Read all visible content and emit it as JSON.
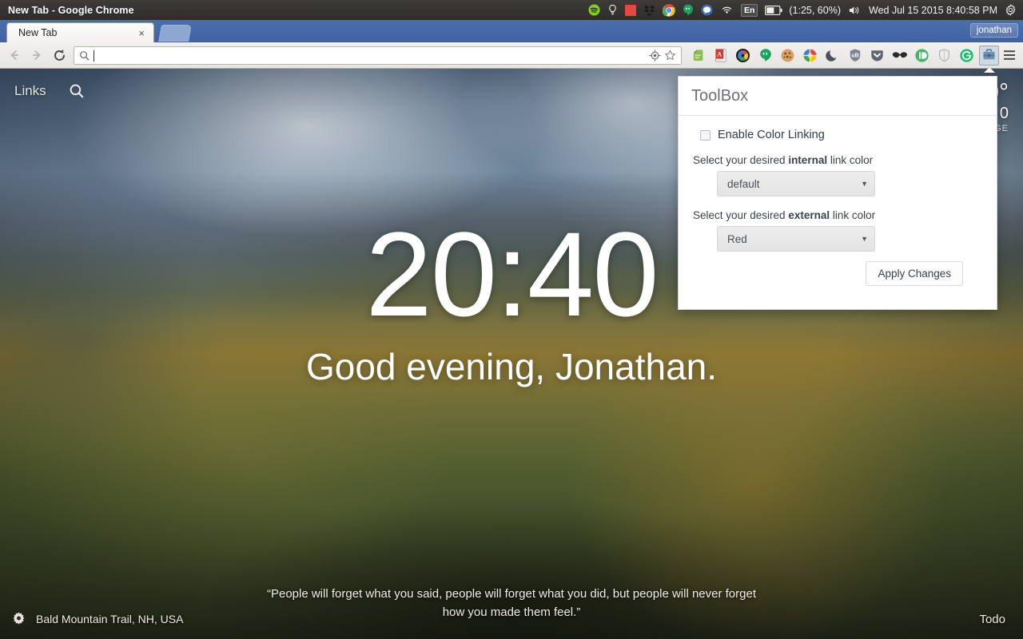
{
  "desktop": {
    "window_title": "New Tab - Google Chrome",
    "tray": {
      "icons": [
        {
          "name": "spotify-icon"
        },
        {
          "name": "lightbulb-icon"
        },
        {
          "name": "red-square-icon"
        },
        {
          "name": "dropbox-icon"
        },
        {
          "name": "chrome-icon"
        },
        {
          "name": "hangouts-icon"
        },
        {
          "name": "messaging-icon"
        },
        {
          "name": "wifi-icon"
        }
      ],
      "keyboard_layout": "En",
      "battery_status": "(1:25, 60%)",
      "clock": "Wed Jul 15 2015  8:40:58 PM"
    }
  },
  "browser": {
    "tab": {
      "title": "New Tab",
      "close_label": "×"
    },
    "user_button_label": "jonathan",
    "omnibox": {
      "value": "",
      "placeholder": ""
    },
    "nav": {
      "back_label": "Back",
      "forward_label": "Forward",
      "reload_label": "Reload"
    },
    "extensions": [
      {
        "name": "evernote-icon"
      },
      {
        "name": "dictionary-icon"
      },
      {
        "name": "colorzilla-icon"
      },
      {
        "name": "hangouts-extension-icon"
      },
      {
        "name": "cookie-icon"
      },
      {
        "name": "colorpicker-icon"
      },
      {
        "name": "night-mode-icon"
      },
      {
        "name": "ublock-icon"
      },
      {
        "name": "pocket-icon"
      },
      {
        "name": "privacy-mask-icon"
      },
      {
        "name": "pushbullet-icon"
      },
      {
        "name": "shield-icon"
      },
      {
        "name": "grammarly-icon"
      },
      {
        "name": "toolbox-icon"
      }
    ]
  },
  "newtab": {
    "links_label": "Links",
    "clock": "20:40",
    "greeting": "Good evening, Jonathan.",
    "quote": "“People will forget what you said, people will forget what you did, but people will never forget how you made them feel.”",
    "location": "Bald Mountain Trail, NH, USA",
    "todo_label": "Todo",
    "weather": {
      "temp": "0°",
      "range": "0",
      "condition": "GE"
    }
  },
  "popup": {
    "title": "ToolBox",
    "checkbox_label": "Enable Color Linking",
    "checkbox_checked": false,
    "internal": {
      "label_pre": "Select your desired ",
      "label_bold": "internal",
      "label_post": " link color",
      "value": "default",
      "arrow": "▼"
    },
    "external": {
      "label_pre": "Select your desired ",
      "label_bold": "external",
      "label_post": " link color",
      "value": "Red",
      "arrow": "▼"
    },
    "apply_label": "Apply Changes"
  }
}
